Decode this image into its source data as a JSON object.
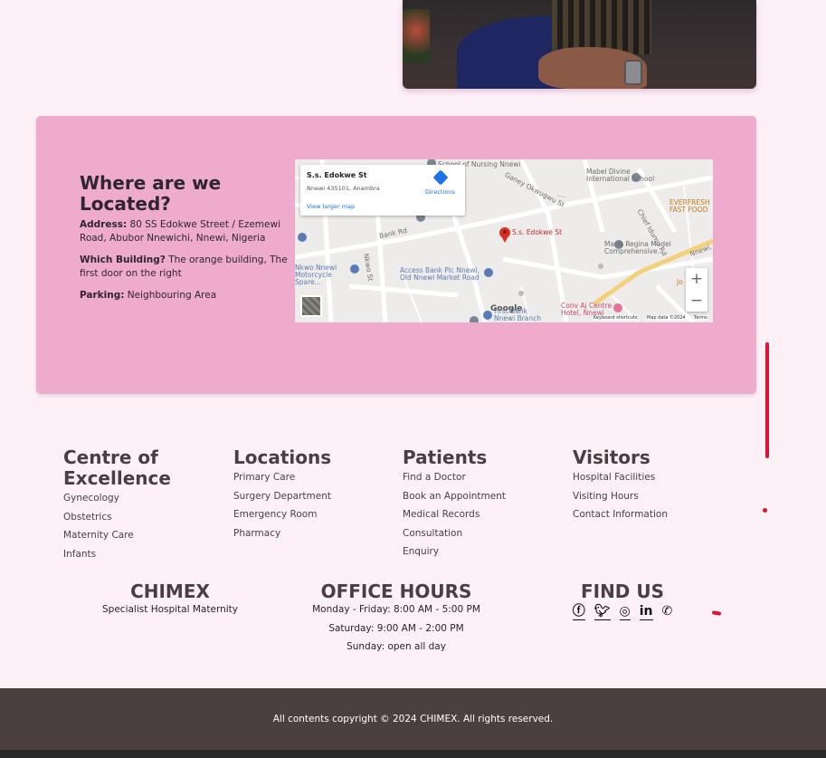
{
  "location": {
    "title": "Where are we Located?",
    "address_label": "Address:",
    "address_value": "80 SS Edokwe Street / Ezemewi Road, Abubor Nnewichi, Nnewi, Nigeria",
    "building_label": "Which Building?",
    "building_value": "The orange building, The first door on the right",
    "parking_label": "Parking:",
    "parking_value": "Neighbouring Area"
  },
  "map": {
    "place_name": "S.s. Edokwe St",
    "place_address": "Nnewi 435101, Anambra",
    "directions_label": "Directions",
    "view_larger_label": "View larger map",
    "pin_label": "S.s. Edokwe St",
    "zoom_in": "+",
    "zoom_out": "−",
    "google_label": "Google",
    "keyboard_shortcuts": "Keyboard shortcuts",
    "map_data": "Map data ©2024",
    "terms": "Terms",
    "labels": {
      "nursing": "School of Nursing Nnewi",
      "mabel": "Mabel Divine International School",
      "everfresh": "EVERFRESH FAST FOOD",
      "maria": "Maria Regina Model Comprehensive...",
      "access": "Access Bank Plc Nnewi, Old Nnewi Market Road",
      "nkwo_spare": "Nkwo Nnewi Motorcycle Spare...",
      "bank_rd": "Bank Rd",
      "nkwo_st": "Nkwo St",
      "conv": "Conv Aj Centre Hotel, Nnewi",
      "first_bank": "First Bank Nnewi Branch",
      "nnewi_road": "Nnewi...",
      "jo": "Jo",
      "ogwugwu": "Ganey Okwugwu St",
      "chief": "Chief Idumu Rd",
      "hotel_now": "Hotel Nnewi"
    }
  },
  "footer": {
    "columns": [
      {
        "title": "Centre of Excellence",
        "links": [
          "Gynecology",
          "Obstetrics",
          "Maternity Care",
          "Infants"
        ]
      },
      {
        "title": "Locations",
        "links": [
          "Primary Care",
          "Surgery Department",
          "Emergency Room",
          "Pharmacy"
        ]
      },
      {
        "title": "Patients",
        "links": [
          "Find a Doctor",
          "Book an Appointment",
          "Medical Records",
          "Consultation",
          "Enquiry"
        ]
      },
      {
        "title": "Visitors",
        "links": [
          "Hospital Facilities",
          "Visiting Hours",
          "Contact Information"
        ]
      }
    ],
    "brand": {
      "name": "CHIMEX",
      "tagline": "Specialist Hospital Maternity"
    },
    "office_hours": {
      "title": "OFFICE HOURS",
      "lines": [
        "Monday - Friday: 8:00 AM - 5:00 PM",
        "Saturday: 9:00 AM - 2:00 PM",
        "Sunday: open all day"
      ]
    },
    "find_us": {
      "title": "FIND US",
      "icons": [
        "facebook-icon",
        "twitter-icon",
        "instagram-icon",
        "linkedin-icon",
        "whatsapp-icon"
      ]
    },
    "copyright": "All contents copyright © 2024 CHIMEX. All rights reserved."
  },
  "colors": {
    "page_bg": "#fdf0f7",
    "card_bg": "#eeabcc",
    "footer_bar": "#4c3f3f",
    "heading": "#4a3e42",
    "annotation_red": "#e3122e"
  }
}
